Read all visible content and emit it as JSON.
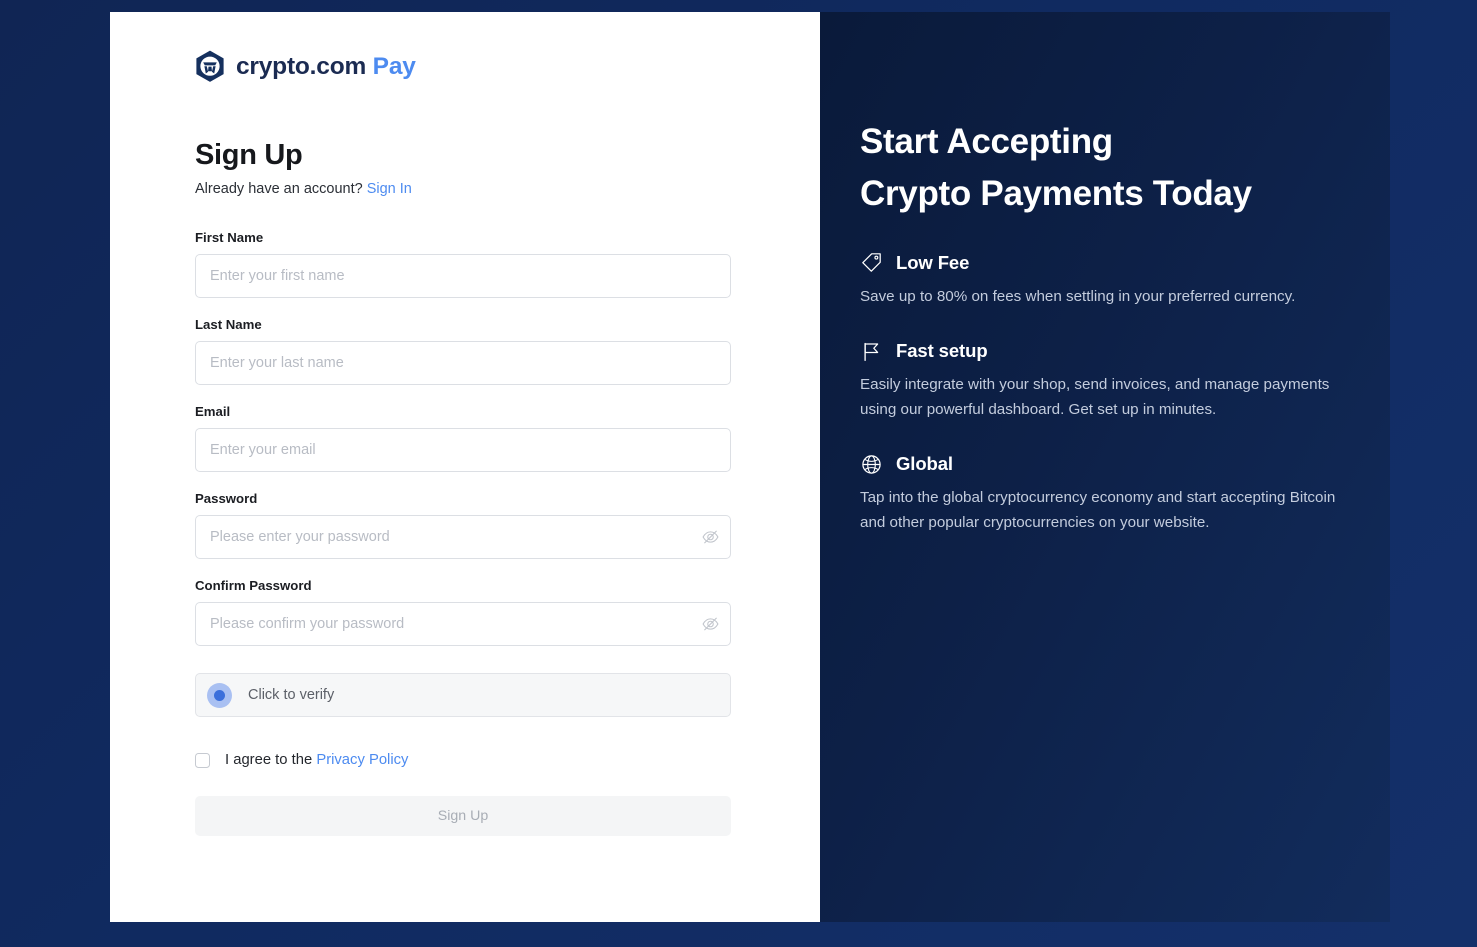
{
  "brand": {
    "name": "crypto.com",
    "product": "Pay",
    "logo_icon": "crypto-com-hexagon-logo",
    "name_color": "#1b2b52",
    "product_color": "#4d8bf0"
  },
  "form": {
    "title": "Sign Up",
    "subtitle_prefix": "Already have an account?",
    "sign_in_link": "Sign In",
    "fields": [
      {
        "label": "First Name",
        "placeholder": "Enter your first name",
        "value": "",
        "type": "text",
        "name": "first-name"
      },
      {
        "label": "Last Name",
        "placeholder": "Enter your last name",
        "value": "",
        "type": "text",
        "name": "last-name"
      },
      {
        "label": "Email",
        "placeholder": "Enter your email",
        "value": "",
        "type": "email",
        "name": "email"
      },
      {
        "label": "Password",
        "placeholder": "Please enter your password",
        "value": "",
        "type": "password",
        "name": "password",
        "toggle_icon": "eye-slash-icon"
      },
      {
        "label": "Confirm Password",
        "placeholder": "Please confirm your password",
        "value": "",
        "type": "password",
        "name": "confirm-password",
        "toggle_icon": "eye-slash-icon"
      }
    ],
    "captcha": {
      "label": "Click to verify",
      "icon": "captcha-target-icon",
      "verified": false
    },
    "agreement": {
      "checked": false,
      "text_prefix": "I agree to the",
      "link_text": "Privacy Policy"
    },
    "submit_label": "Sign Up",
    "submit_disabled": true
  },
  "promo": {
    "title_line1": "Start Accepting",
    "title_line2": "Crypto Payments Today",
    "features": [
      {
        "icon": "price-tag-icon",
        "title": "Low Fee",
        "description": "Save up to 80% on fees when settling in your preferred currency."
      },
      {
        "icon": "flag-icon",
        "title": "Fast setup",
        "description": "Easily integrate with your shop, send invoices, and manage payments using our powerful dashboard. Get set up in minutes."
      },
      {
        "icon": "globe-icon",
        "title": "Global",
        "description": "Tap into the global cryptocurrency economy and start accepting Bitcoin and other popular cryptocurrencies on your website."
      }
    ]
  },
  "colors": {
    "page_background": "#10295c",
    "promo_background": "#0d2047",
    "card_background": "#ffffff",
    "accent_blue": "#4d8bf0"
  }
}
